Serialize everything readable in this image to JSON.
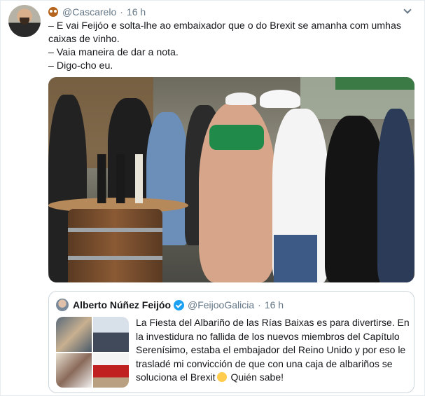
{
  "tweet": {
    "handle": "@Cascarelo",
    "separator": "·",
    "time": "16 h",
    "lines": [
      "– E vai Feijóo e solta-lhe ao embaixador que o do Brexit se amanha com umhas caixas de vinho.",
      "– Vaia maneira de dar a nota.",
      "– Digo-cho eu."
    ]
  },
  "quote": {
    "name": "Alberto Núñez Feijóo",
    "handle": "@FeijooGalicia",
    "separator": "·",
    "time": "16 h",
    "text_before_emoji": "La Fiesta del Albariño de las Rías Baixas es para divertirse. En la investidura no fallida de los nuevos miembros del Capítulo Serenísimo, estaba el embajador del Reino Unido y por eso le trasladé mi convicción de que con una caja de albariños se soluciona el Brexit",
    "text_after_emoji": " Quién sabe!"
  },
  "icons": {
    "owl": "owl-emoji-icon",
    "menu": "chevron-down-icon",
    "verified": "verified-badge-icon",
    "emoji": "winking-face-emoji-icon"
  },
  "colors": {
    "secondary_text": "#657786",
    "verified": "#1da1f2",
    "border": "#ccd6dd"
  }
}
